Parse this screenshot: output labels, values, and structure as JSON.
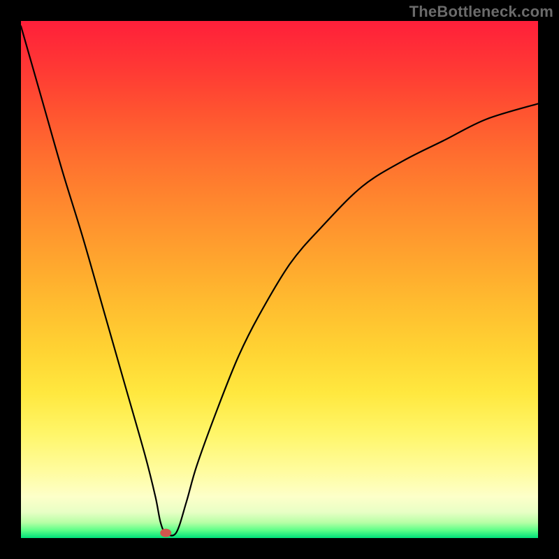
{
  "watermark": "TheBottleneck.com",
  "colors": {
    "curve_stroke": "#000000",
    "marker_fill": "#d0564d"
  },
  "chart_data": {
    "type": "line",
    "title": "",
    "xlabel": "",
    "ylabel": "",
    "xlim": [
      0,
      100
    ],
    "ylim": [
      0,
      100
    ],
    "grid": false,
    "legend": false,
    "annotations": [],
    "series": [
      {
        "name": "bottleneck-curve",
        "x": [
          0,
          4,
          8,
          12,
          16,
          20,
          24,
          26,
          27,
          28,
          30,
          32,
          34,
          38,
          42,
          46,
          52,
          58,
          66,
          74,
          82,
          90,
          100
        ],
        "values": [
          99,
          85,
          71,
          58,
          44,
          30,
          16,
          8,
          3,
          1,
          1,
          7,
          14,
          25,
          35,
          43,
          53,
          60,
          68,
          73,
          77,
          81,
          84
        ]
      }
    ],
    "marker": {
      "x": 28,
      "y": 1
    }
  }
}
